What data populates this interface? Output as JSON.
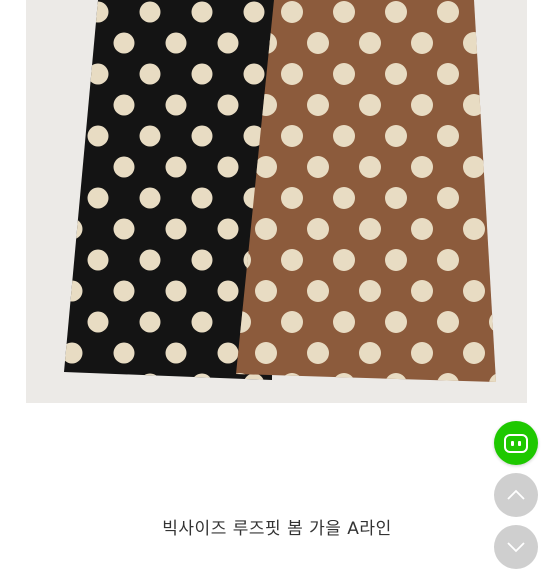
{
  "product": {
    "title": "빅사이즈 루즈핏 봄 가을 A라인"
  },
  "colors": {
    "chat_button": "#1ec800",
    "nav_button": "#cfcfcf",
    "skirt_black": "#141414",
    "skirt_brown": "#8c5b3c",
    "polka_dot": "#e8dcc3"
  },
  "icons": {
    "chat": "chat-bubble-icon",
    "scroll_up": "chevron-up-icon",
    "scroll_down": "chevron-down-icon"
  }
}
